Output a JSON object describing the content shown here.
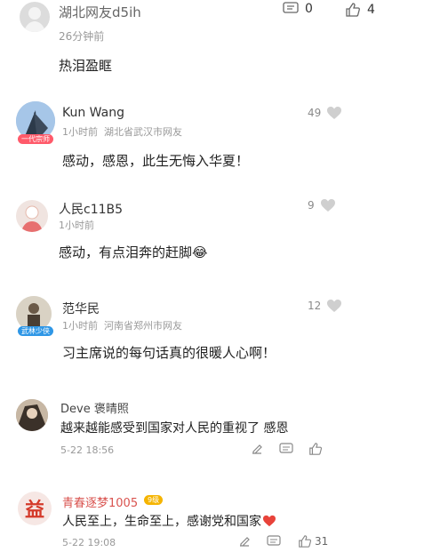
{
  "comments": [
    {
      "user": "湖北网友d5ih",
      "time": "26分钟前",
      "text": "热泪盈眶",
      "comment_count": "0",
      "like_count": "4"
    },
    {
      "user": "Kun Wang",
      "time": "1小时前",
      "location": "湖北省武汉市网友",
      "badge": "一代宗师",
      "text": "感动，感恩，此生无悔入华夏！",
      "like_count": "49"
    },
    {
      "user": "人民c11B5",
      "time": "1小时前",
      "text": "感动，有点泪奔的赶脚😂",
      "like_count": "9"
    },
    {
      "user": "范华民",
      "time": "1小时前",
      "location": "河南省郑州市网友",
      "badge": "武林少侠",
      "text": "习主席说的每句话真的很暖人心啊！",
      "like_count": "12"
    },
    {
      "user": "Deve 褒晴照",
      "text": "越来越能感受到国家对人民的重视了 感恩",
      "date": "5-22 18:56"
    },
    {
      "user": "青春逐梦1005",
      "avatar_char": "益",
      "user_badge": "9级",
      "text": "人民至上，生命至上，感谢党和国家",
      "date": "5-22 19:08",
      "like_count": "31"
    }
  ],
  "colors": {
    "accent_red": "#e8433a",
    "gold": "#f5b400",
    "gray": "#999999"
  }
}
